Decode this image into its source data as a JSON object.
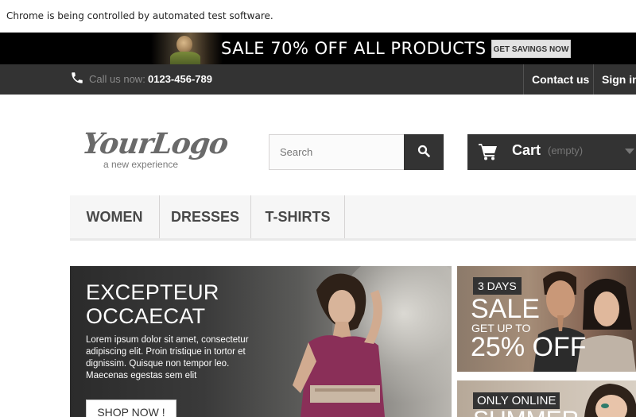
{
  "automation_notice": "Chrome is being controlled by automated test software.",
  "promo": {
    "text": "SALE 70% OFF ALL PRODUCTS",
    "button_label": "GET SAVINGS NOW"
  },
  "nav": {
    "phone_icon": "phone-icon",
    "call_label": "Call us now:",
    "phone_number": "0123-456-789",
    "contact_label": "Contact us",
    "signin_label": "Sign in"
  },
  "logo": {
    "main": "YourLogo",
    "tagline": "a new experience"
  },
  "search": {
    "placeholder": "Search",
    "value": "",
    "icon": "search-icon"
  },
  "cart": {
    "icon": "cart-icon",
    "label": "Cart",
    "status": "(empty)"
  },
  "menu": {
    "items": [
      {
        "label": "WOMEN"
      },
      {
        "label": "DRESSES"
      },
      {
        "label": "T-SHIRTS"
      }
    ]
  },
  "hero": {
    "title_line1": "EXCEPTEUR",
    "title_line2": "OCCAECAT",
    "body": "Lorem ipsum dolor sit amet, consectetur adipiscing elit. Proin tristique in tortor et dignissim. Quisque non tempor leo. Maecenas egestas sem elit",
    "button_label": "SHOP NOW !"
  },
  "banner_top": {
    "badge": "3 DAYS",
    "headline": "SALE",
    "subline": "GET UP TO",
    "discount": "25% OFF"
  },
  "banner_bottom": {
    "badge": "ONLY ONLINE",
    "headline": "SUMMER"
  },
  "colors": {
    "dark_bar": "#333333",
    "promo_bg": "#000000",
    "menu_bg": "#f6f6f6",
    "text_muted": "#777777"
  }
}
